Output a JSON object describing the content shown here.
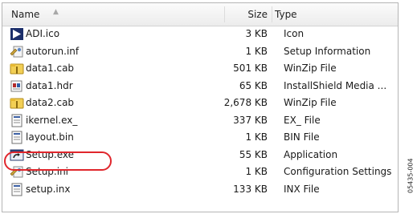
{
  "header": {
    "name": "Name",
    "size": "Size",
    "type": "Type"
  },
  "files": [
    {
      "name": "ADI.ico",
      "size": "3 KB",
      "type": "Icon",
      "icon": "ico-file-icon"
    },
    {
      "name": "autorun.inf",
      "size": "1 KB",
      "type": "Setup Information",
      "icon": "setup-info-icon"
    },
    {
      "name": "data1.cab",
      "size": "501 KB",
      "type": "WinZip File",
      "icon": "winzip-icon"
    },
    {
      "name": "data1.hdr",
      "size": "65 KB",
      "type": "InstallShield Media ...",
      "icon": "installshield-icon"
    },
    {
      "name": "data2.cab",
      "size": "2,678 KB",
      "type": "WinZip File",
      "icon": "winzip-icon"
    },
    {
      "name": "ikernel.ex_",
      "size": "337 KB",
      "type": "EX_ File",
      "icon": "generic-file-icon"
    },
    {
      "name": "layout.bin",
      "size": "1 KB",
      "type": "BIN File",
      "icon": "generic-file-icon"
    },
    {
      "name": "Setup.exe",
      "size": "55 KB",
      "type": "Application",
      "icon": "setup-exe-icon"
    },
    {
      "name": "Setup.ini",
      "size": "1 KB",
      "type": "Configuration Settings",
      "icon": "setup-info-icon"
    },
    {
      "name": "setup.inx",
      "size": "133 KB",
      "type": "INX File",
      "icon": "generic-file-icon"
    }
  ],
  "figure_code": "05435-004",
  "colors": {
    "highlight": "#e0262c"
  }
}
